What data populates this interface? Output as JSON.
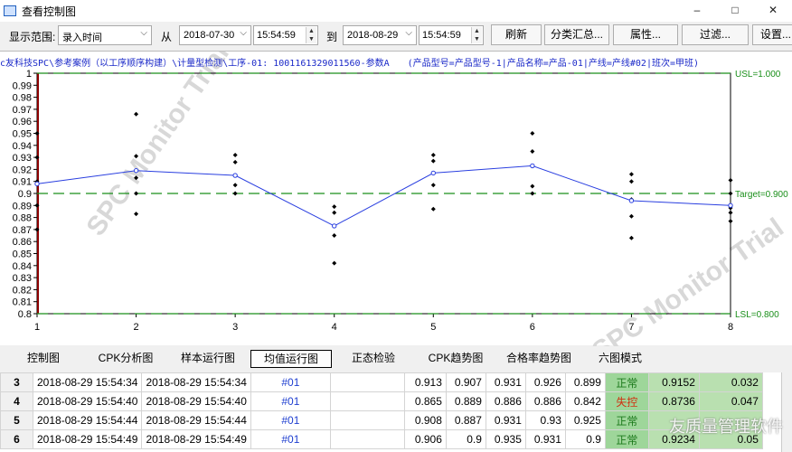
{
  "window": {
    "title": "查看控制图",
    "controls": [
      "–",
      "□",
      "✕"
    ]
  },
  "toolbar": {
    "range_label": "显示范围:",
    "range_value": "录入时间",
    "from_label": "从",
    "from_date": "2018-07-30",
    "from_time": "15:54:59",
    "to_label": "到",
    "to_date": "2018-08-29",
    "to_time": "15:54:59",
    "refresh": "刷新",
    "summary": "分类汇总...",
    "properties": "属性...",
    "filter": "过滤...",
    "settings": "设置..."
  },
  "chart_header": {
    "path": "c友科技SPC\\参考案例（以工序顺序构建）\\计量型检测\\工序-01: 1001161329011560-参数A",
    "attributes": "(产品型号=产品型号-1|产品名称=产品-01|产线=产线#02|班次=甲班)"
  },
  "chart_data": {
    "type": "line",
    "x": [
      1,
      2,
      3,
      4,
      5,
      6,
      7,
      8
    ],
    "means": [
      0.908,
      0.919,
      0.915,
      0.873,
      0.917,
      0.923,
      0.894,
      0.89
    ],
    "points": [
      [
        0.95,
        0.93,
        0.91,
        0.89,
        0.87
      ],
      [
        0.966,
        0.931,
        0.913,
        0.9,
        0.883
      ],
      [
        0.932,
        0.926,
        0.907,
        0.9
      ],
      [
        0.889,
        0.884,
        0.865,
        0.842
      ],
      [
        0.932,
        0.927,
        0.907,
        0.887
      ],
      [
        0.95,
        0.935,
        0.906,
        0.9
      ],
      [
        0.916,
        0.91,
        0.895,
        0.881,
        0.863
      ],
      [
        0.911,
        0.9,
        0.888,
        0.884,
        0.877
      ]
    ],
    "ylim": [
      0.8,
      1.0
    ],
    "yticks": [
      0.8,
      0.81,
      0.82,
      0.83,
      0.84,
      0.85,
      0.86,
      0.87,
      0.88,
      0.89,
      0.9,
      0.91,
      0.92,
      0.93,
      0.94,
      0.95,
      0.96,
      0.97,
      0.98,
      0.99,
      1
    ],
    "usl": 1.0,
    "target": 0.9,
    "lsl": 0.8,
    "usl_label": "USL=1.000",
    "target_label": "Target=0.900",
    "lsl_label": "LSL=0.800",
    "watermark": "SPC Monitor Trial",
    "colors": {
      "line": "#2a3fe0",
      "limit": "#1a8f1a",
      "point": "#000000",
      "left_bar": "#8b0000"
    }
  },
  "tabs": [
    "控制图",
    "CPK分析图",
    "样本运行图",
    "均值运行图",
    "正态检验",
    "CPK趋势图",
    "合格率趋势图",
    "六图模式"
  ],
  "active_tab": "均值运行图",
  "table": {
    "rows": [
      {
        "no": "3",
        "t1": "2018-08-29 15:54:34",
        "t2": "2018-08-29 15:54:34",
        "line": "#01",
        "v1": "0.913",
        "v2": "0.907",
        "v3": "0.931",
        "v4": "0.926",
        "v5": "0.899",
        "status": "正常",
        "mean": "0.9152",
        "range": "0.032"
      },
      {
        "no": "4",
        "t1": "2018-08-29 15:54:40",
        "t2": "2018-08-29 15:54:40",
        "line": "#01",
        "v1": "0.865",
        "v2": "0.889",
        "v3": "0.886",
        "v4": "0.886",
        "v5": "0.842",
        "status": "失控",
        "mean": "0.8736",
        "range": "0.047"
      },
      {
        "no": "5",
        "t1": "2018-08-29 15:54:44",
        "t2": "2018-08-29 15:54:44",
        "line": "#01",
        "v1": "0.908",
        "v2": "0.887",
        "v3": "0.931",
        "v4": "0.93",
        "v5": "0.925",
        "status": "正常",
        "mean": "",
        "range": ""
      },
      {
        "no": "6",
        "t1": "2018-08-29 15:54:49",
        "t2": "2018-08-29 15:54:49",
        "line": "#01",
        "v1": "0.906",
        "v2": "0.9",
        "v3": "0.935",
        "v4": "0.931",
        "v5": "0.9",
        "status": "正常",
        "mean": "0.9234",
        "range": "0.05"
      }
    ]
  },
  "footer_watermark": "友质量管理软件"
}
